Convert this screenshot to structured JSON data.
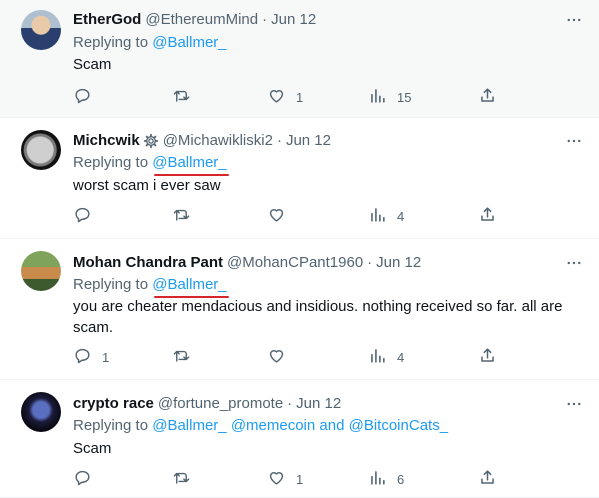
{
  "tweets": [
    {
      "name": "EtherGod",
      "handle": "@EthereumMind",
      "separator": "·",
      "date": "Jun 12",
      "replying_prefix": "Replying to",
      "replying_to": "@Ballmer_",
      "text": "Scam",
      "counts": {
        "replies": "",
        "retweets": "",
        "likes": "1",
        "views": "15"
      }
    },
    {
      "name": "Michcwik",
      "handle": "@Michawikliski2",
      "separator": "·",
      "date": "Jun 12",
      "replying_prefix": "Replying to",
      "replying_to": "@Ballmer_",
      "text": "worst scam i ever saw",
      "counts": {
        "replies": "",
        "retweets": "",
        "likes": "",
        "views": "4"
      }
    },
    {
      "name": "Mohan Chandra Pant",
      "handle": "@MohanCPant1960",
      "separator": "·",
      "date": "Jun 12",
      "replying_prefix": "Replying to",
      "replying_to": "@Ballmer_",
      "text": "you are cheater mendacious and insidious. nothing received so far. all are scam.",
      "counts": {
        "replies": "1",
        "retweets": "",
        "likes": "",
        "views": "4"
      }
    },
    {
      "name": "crypto race",
      "handle": "@fortune_promote",
      "separator": "·",
      "date": "Jun 12",
      "replying_prefix": "Replying to",
      "replying_to": "@Ballmer_",
      "replying_to_2": "@memecoin",
      "replying_and": "and",
      "replying_to_3": "@BitcoinCats_",
      "text": "Scam",
      "counts": {
        "replies": "",
        "retweets": "",
        "likes": "1",
        "views": "6"
      }
    }
  ],
  "icons": {
    "reply": "reply-icon",
    "retweet": "retweet-icon",
    "like": "heart-icon",
    "views": "views-icon",
    "share": "share-icon",
    "more": "more-icon",
    "verified_gear": "gear-icon"
  },
  "colors": {
    "link": "#1d9bf0",
    "muted": "#536471",
    "annotation_underline": "#d7262a"
  }
}
